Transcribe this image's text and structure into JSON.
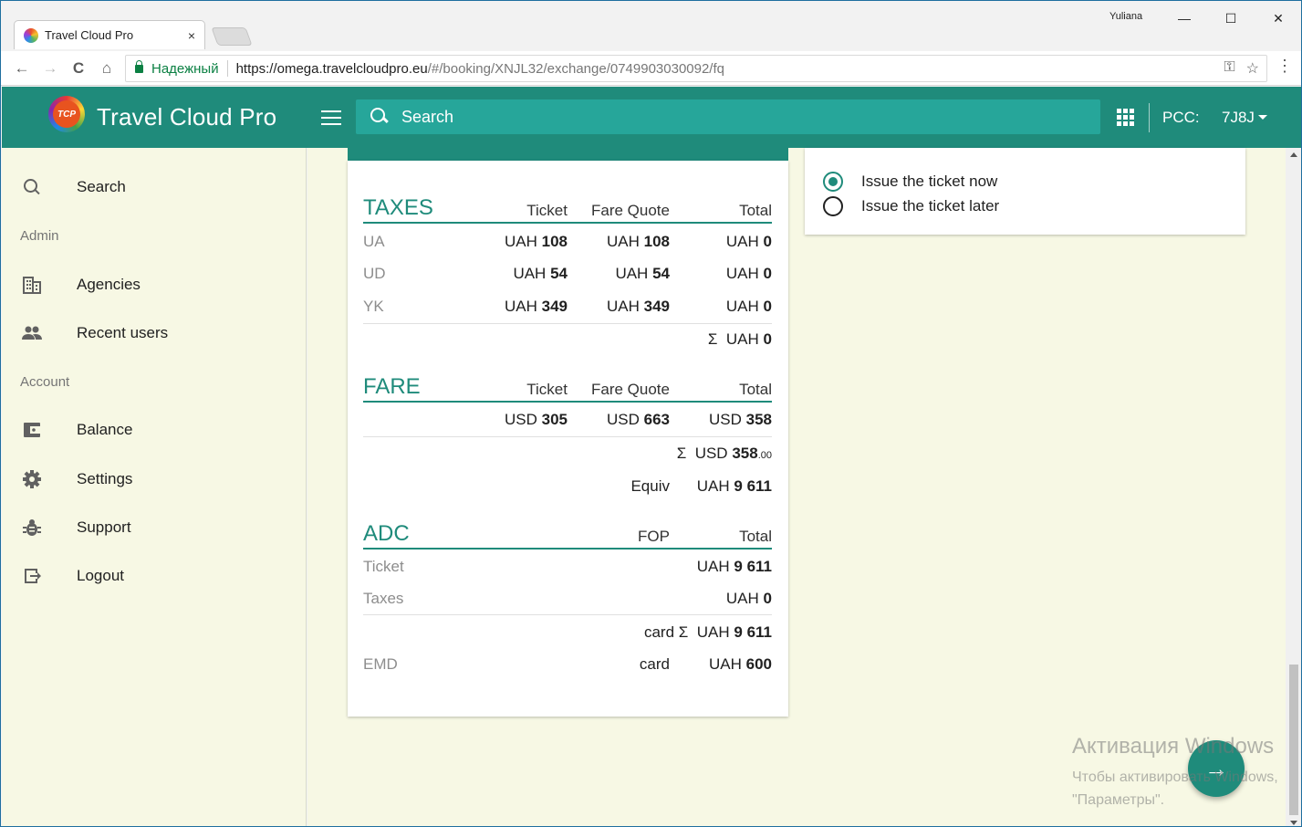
{
  "browser": {
    "tab_title": "Travel Cloud Pro",
    "tab_close": "×",
    "user_name": "Yuliana",
    "window_controls": {
      "minimize": "—",
      "maximize": "☐",
      "close": "✕"
    },
    "nav": {
      "back": "←",
      "forward": "→",
      "reload": "C",
      "home": "⌂"
    },
    "secure_label": "Надежный",
    "url_host": "https://omega.travelcloudpro.eu",
    "url_path": "/#/booking/XNJL32/exchange/0749903030092/fq",
    "icons": [
      "key-icon",
      "star-icon",
      "menu-dots-icon"
    ]
  },
  "header": {
    "brand": "Travel Cloud Pro",
    "logo_text": "TCP",
    "search_label": "Search",
    "pcc_label": "PCC:",
    "pcc_value": "7J8J"
  },
  "sidebar": {
    "items": [
      {
        "label": "Search",
        "icon": "search-icon"
      },
      {
        "label": "Agencies",
        "icon": "building-icon"
      },
      {
        "label": "Recent users",
        "icon": "people-icon"
      },
      {
        "label": "Balance",
        "icon": "wallet-icon"
      },
      {
        "label": "Settings",
        "icon": "gear-icon"
      },
      {
        "label": "Support",
        "icon": "bug-icon"
      },
      {
        "label": "Logout",
        "icon": "logout-icon"
      }
    ],
    "sections": {
      "admin": "Admin",
      "account": "Account"
    }
  },
  "taxes": {
    "title": "TAXES",
    "columns": [
      "Ticket",
      "Fare Quote",
      "Total"
    ],
    "rows": [
      {
        "code": "UA",
        "ticket_cur": "UAH",
        "ticket": "108",
        "fq_cur": "UAH",
        "fq": "108",
        "total_cur": "UAH",
        "total": "0"
      },
      {
        "code": "UD",
        "ticket_cur": "UAH",
        "ticket": "54",
        "fq_cur": "UAH",
        "fq": "54",
        "total_cur": "UAH",
        "total": "0"
      },
      {
        "code": "YK",
        "ticket_cur": "UAH",
        "ticket": "349",
        "fq_cur": "UAH",
        "fq": "349",
        "total_cur": "UAH",
        "total": "0"
      }
    ],
    "sum_symbol": "Σ",
    "sum_cur": "UAH",
    "sum_value": "0"
  },
  "fare": {
    "title": "FARE",
    "columns": [
      "Ticket",
      "Fare Quote",
      "Total"
    ],
    "ticket_cur": "USD",
    "ticket": "305",
    "fq_cur": "USD",
    "fq": "663",
    "total_cur": "USD",
    "total": "358",
    "sum_symbol": "Σ",
    "sum_cur": "USD",
    "sum_value": "358",
    "sum_decimals": ".00",
    "equiv_label": "Equiv",
    "equiv_cur": "UAH",
    "equiv_value": "9 611"
  },
  "adc": {
    "title": "ADC",
    "columns": [
      "FOP",
      "Total"
    ],
    "ticket_label": "Ticket",
    "ticket_cur": "UAH",
    "ticket_value": "9 611",
    "taxes_label": "Taxes",
    "taxes_cur": "UAH",
    "taxes_value": "0",
    "sum_fop": "card",
    "sum_symbol": "Σ",
    "sum_cur": "UAH",
    "sum_value": "9 611",
    "emd_label": "EMD",
    "emd_fop": "card",
    "emd_cur": "UAH",
    "emd_value": "600"
  },
  "issue": {
    "options": [
      {
        "label": "Issue the ticket now",
        "checked": true
      },
      {
        "label": "Issue the ticket later",
        "checked": false
      }
    ]
  },
  "watermark": {
    "line1": "Активация Windows",
    "line2": "Чтобы активировать Windows,",
    "line3": "\"Параметры\"."
  },
  "fab_icon": "→",
  "colors": {
    "primary": "#1f8b7b",
    "search_bg": "#26a69a",
    "sidebar_bg": "#f7f8e4",
    "secure": "#0b8043"
  }
}
